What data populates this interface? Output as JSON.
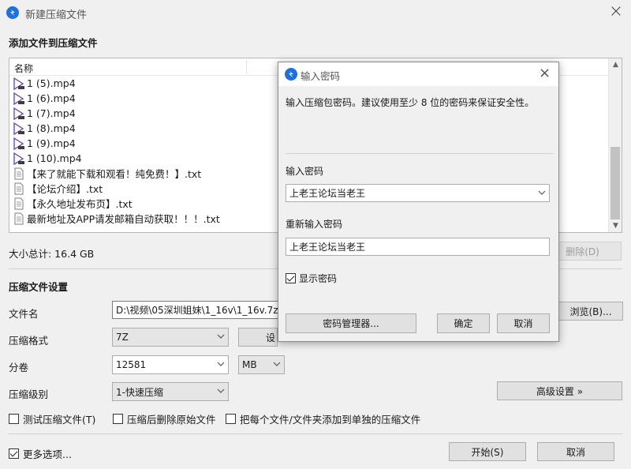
{
  "window": {
    "title": "新建压缩文件"
  },
  "files_section": {
    "title": "添加文件到压缩文件",
    "column_name": "名称",
    "files": [
      {
        "name": "1 (5).mp4",
        "type": "video"
      },
      {
        "name": "1 (6).mp4",
        "type": "video"
      },
      {
        "name": "1 (7).mp4",
        "type": "video"
      },
      {
        "name": "1 (8).mp4",
        "type": "video"
      },
      {
        "name": "1 (9).mp4",
        "type": "video"
      },
      {
        "name": "1 (10).mp4",
        "type": "video"
      },
      {
        "name": "【来了就能下载和观看！纯免费！】.txt",
        "type": "text"
      },
      {
        "name": "【论坛介绍】.txt",
        "type": "text"
      },
      {
        "name": "【永久地址发布页】.txt",
        "type": "text"
      },
      {
        "name": "最新地址及APP请发邮箱自动获取！！！.txt",
        "type": "text"
      }
    ],
    "total_size": "大小总计: 16.4 GB",
    "delete_button": "删除(D)"
  },
  "settings": {
    "title": "压缩文件设置",
    "filename_label": "文件名",
    "filename_value": "D:\\视频\\05深圳姐妹\\1_16v\\1_16v.7z",
    "browse_button": "浏览(B)...",
    "format_label": "压缩格式",
    "format_value": "7Z",
    "set_button_partial": "设",
    "split_label": "分卷",
    "split_value": "12581",
    "split_unit": "MB",
    "level_label": "压缩级别",
    "level_value": "1-快速压缩",
    "advanced_button": "高级设置 »",
    "options": [
      {
        "label": "测试压缩文件(T)",
        "checked": false
      },
      {
        "label": "压缩后删除原始文件",
        "checked": false
      },
      {
        "label": "把每个文件/文件夹添加到单独的压缩文件",
        "checked": false
      }
    ],
    "more_options": {
      "label": "更多选项...",
      "checked": true
    }
  },
  "footer": {
    "start_button": "开始(S)",
    "cancel_button": "取消"
  },
  "password_dialog": {
    "title": "输入密码",
    "description": "输入压缩包密码。建议使用至少 8 位的密码来保证安全性。",
    "password_label": "输入密码",
    "password_value": "上老王论坛当老王",
    "confirm_label": "重新输入密码",
    "confirm_value": "上老王论坛当老王",
    "show_password": {
      "label": "显示密码",
      "checked": true
    },
    "manager_button": "密码管理器...",
    "ok_button": "确定",
    "cancel_button": "取消"
  },
  "colors": {
    "accent": "#1f6fe0",
    "window_bg": "#f0f0f0"
  }
}
